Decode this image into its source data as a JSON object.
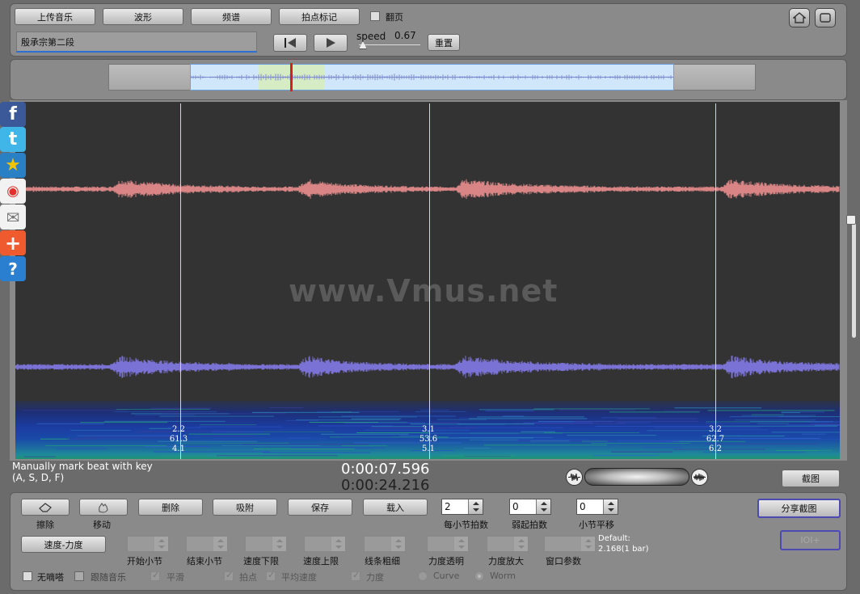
{
  "top": {
    "upload_label": "上传音乐",
    "waveform_label": "波形",
    "spectrum_label": "频谱",
    "beat_mark_label": "拍点标记",
    "flip_page_label": "翻页",
    "title_value": "殷承宗第二段",
    "speed_label": "speed",
    "speed_value": "0.67",
    "reset_label": "重置"
  },
  "canvas": {
    "watermark": "www.Vmus.net",
    "beats": [
      {
        "l1": "2.2",
        "l2": "61.3",
        "l3": "4.1"
      },
      {
        "l1": "3.1",
        "l2": "53.6",
        "l3": "5.1"
      },
      {
        "l1": "3.2",
        "l2": "62.7",
        "l3": "6.2"
      }
    ]
  },
  "status": {
    "hint_line1": "Manually mark beat with key",
    "hint_line2": "(A, S, D, F)",
    "current_time": "0:00:07.596",
    "total_time": "0:00:24.216",
    "screenshot_label": "截图"
  },
  "tools": {
    "erase_label": "擦除",
    "move_label": "移动",
    "delete_label": "删除",
    "snap_label": "吸附",
    "save_label": "保存",
    "load_label": "载入",
    "beats_per_bar_value": "2",
    "beats_per_bar_label": "每小节拍数",
    "pickup_value": "0",
    "pickup_label": "弱起拍数",
    "bar_shift_value": "0",
    "bar_shift_label": "小节平移",
    "share_label": "分享截图",
    "ioi_label": "IOI+",
    "speed_dynamics_label": "速度-力度",
    "start_bar_label": "开始小节",
    "end_bar_label": "结束小节",
    "speed_min_label": "速度下限",
    "speed_max_label": "速度上限",
    "line_width_label": "线条粗细",
    "dyn_alpha_label": "力度透明",
    "dyn_scale_label": "力度放大",
    "window_param_label": "窗口参数",
    "default_line1": "Default:",
    "default_line2": "2.168(1 bar)",
    "no_click_label": "无嘀嗒",
    "follow_music_label": "跟随音乐",
    "smooth_label": "平滑",
    "beat_point_label": "拍点",
    "avg_speed_label": "平均速度",
    "dynamics_label": "力度",
    "curve_label": "Curve",
    "worm_label": "Worm"
  },
  "colors": {
    "accent_blue": "#2b6fd4",
    "upper_wave": "#d98585",
    "lower_wave": "#7b72d6",
    "beat_line": "#f0f000",
    "playhead": "#d81e1e"
  }
}
